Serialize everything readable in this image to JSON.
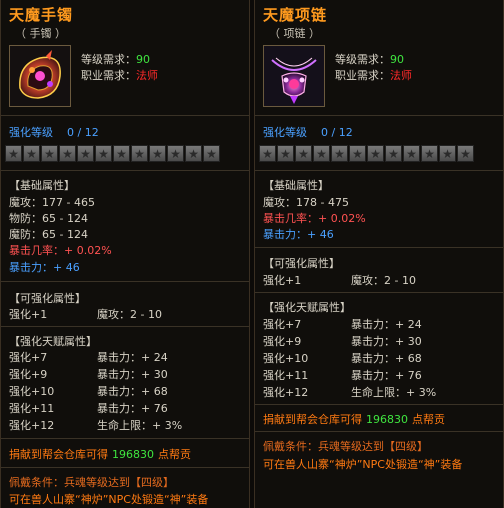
{
  "items": [
    {
      "name": "天魔手镯",
      "type": "（ 手镯 ）",
      "level_req_label": "等级需求：",
      "level_req_value": "90",
      "class_req_label": "职业需求：",
      "class_req_value": "法师",
      "enhance_label": "强化等级",
      "enhance_value": "0 / 12",
      "stars": 12,
      "base_header": "【基础属性】",
      "base_attrs": [
        {
          "text": "魔攻：177 - 465",
          "color": "normal"
        },
        {
          "text": "物防：65 - 124",
          "color": "normal"
        },
        {
          "text": "魔防：65 - 124",
          "color": "normal"
        },
        {
          "text": "暴击几率：+ 0.02%",
          "color": "red"
        },
        {
          "text": "暴击力：+ 46",
          "color": "blue"
        }
      ],
      "enh_header": "【可强化属性】",
      "enh_attrs": [
        {
          "lv": "强化+1",
          "stat": "魔攻：2 - 10"
        }
      ],
      "talent_header": "【强化天赋属性】",
      "talent_attrs": [
        {
          "lv": "强化+7",
          "stat": "暴击力：+ 24"
        },
        {
          "lv": "强化+9",
          "stat": "暴击力：+ 30"
        },
        {
          "lv": "强化+10",
          "stat": "暴击力：+ 68"
        },
        {
          "lv": "强化+11",
          "stat": "暴击力：+ 76"
        },
        {
          "lv": "强化+12",
          "stat": "生命上限：+ 3%"
        }
      ],
      "donate_prefix": "捐献到帮会仓库可得",
      "donate_value": "196830",
      "donate_suffix": "点帮贡",
      "equip_condition": "佩戴条件：兵魂等级达到【四级】",
      "npc_text": "可在兽人山寨“神炉”NPC处锻造“神”装备"
    },
    {
      "name": "天魔项链",
      "type": "（ 项链 ）",
      "level_req_label": "等级需求：",
      "level_req_value": "90",
      "class_req_label": "职业需求：",
      "class_req_value": "法师",
      "enhance_label": "强化等级",
      "enhance_value": "0 / 12",
      "stars": 12,
      "base_header": "【基础属性】",
      "base_attrs": [
        {
          "text": "魔攻：178 - 475",
          "color": "normal"
        },
        {
          "text": "暴击几率：+ 0.02%",
          "color": "red"
        },
        {
          "text": "暴击力：+ 46",
          "color": "blue"
        }
      ],
      "enh_header": "【可强化属性】",
      "enh_attrs": [
        {
          "lv": "强化+1",
          "stat": "魔攻：2 - 10"
        }
      ],
      "talent_header": "【强化天赋属性】",
      "talent_attrs": [
        {
          "lv": "强化+7",
          "stat": "暴击力：+ 24"
        },
        {
          "lv": "强化+9",
          "stat": "暴击力：+ 30"
        },
        {
          "lv": "强化+10",
          "stat": "暴击力：+ 68"
        },
        {
          "lv": "强化+11",
          "stat": "暴击力：+ 76"
        },
        {
          "lv": "强化+12",
          "stat": "生命上限：+ 3%"
        }
      ],
      "donate_prefix": "捐献到帮会仓库可得",
      "donate_value": "196830",
      "donate_suffix": "点帮贡",
      "equip_condition": "佩戴条件：兵魂等级达到【四级】",
      "npc_text": "可在兽人山寨“神炉”NPC处锻造“神”装备"
    }
  ],
  "colors": {
    "title": "#ff9a1e",
    "green": "#3fe43f",
    "red": "#ff2a2a",
    "blue": "#4aa0ff",
    "orange": "#ff7a12"
  },
  "icons": [
    "bracelet-icon",
    "necklace-icon",
    "star-icon"
  ]
}
